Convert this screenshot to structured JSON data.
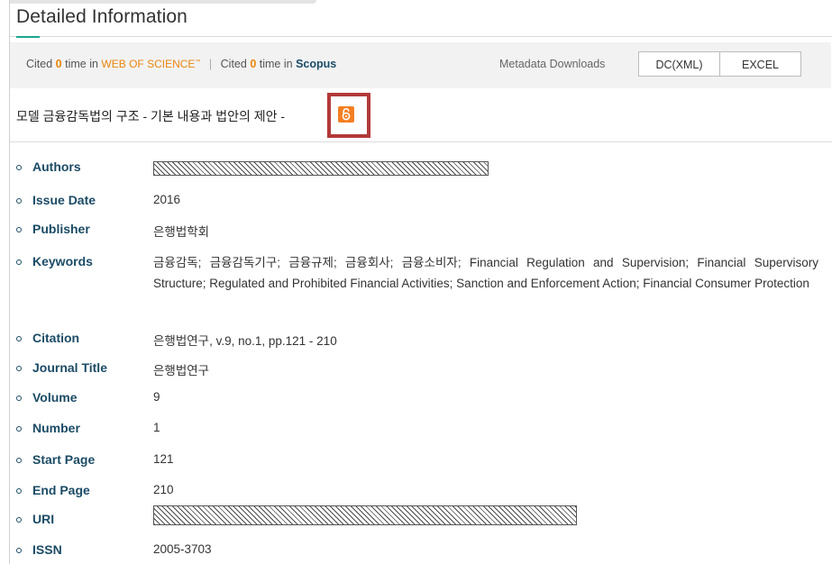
{
  "header": {
    "title": "Detailed Information"
  },
  "citation_bar": {
    "cited_prefix": "Cited",
    "wos_count": "0",
    "time_in": "time in",
    "wos_name": "WEB OF SCIENCE",
    "wos_tm": "™",
    "separator": "|",
    "scopus_count": "0",
    "scopus_name": "Scopus",
    "metadata_label": "Metadata Downloads",
    "dc_button": "DC(XML)",
    "excel_button": "EXCEL"
  },
  "item": {
    "title": "모델 금융감독법의 구조 - 기본 내용과 법안의 제안 -",
    "open_access_icon": "open-lock-icon"
  },
  "fields": [
    {
      "label": "Authors",
      "value": "",
      "redacted": true
    },
    {
      "label": "Issue Date",
      "value": "2016"
    },
    {
      "label": "Publisher",
      "value": "은행법학회"
    },
    {
      "label": "Keywords",
      "value": "금융감독; 금융감독기구; 금융규제; 금융회사; 금융소비자; Financial Regulation and Supervision; Financial Supervisory Structure; Regulated and Prohibited Financial Activities; Sanction and Enforcement Action; Financial Consumer Protection"
    },
    {
      "label": "Citation",
      "value": "은행법연구, v.9, no.1, pp.121 - 210"
    },
    {
      "label": "Journal Title",
      "value": "은행법연구"
    },
    {
      "label": "Volume",
      "value": "9"
    },
    {
      "label": "Number",
      "value": "1"
    },
    {
      "label": "Start Page",
      "value": "121"
    },
    {
      "label": "End Page",
      "value": "210"
    },
    {
      "label": "URI",
      "value": "",
      "redacted": true
    },
    {
      "label": "ISSN",
      "value": "2005-3703"
    }
  ],
  "colors": {
    "accent": "#1aa591",
    "label": "#1b4b66",
    "highlight_box": "#b23a3a",
    "oa_icon": "#f47f23",
    "wos": "#e9850e"
  }
}
